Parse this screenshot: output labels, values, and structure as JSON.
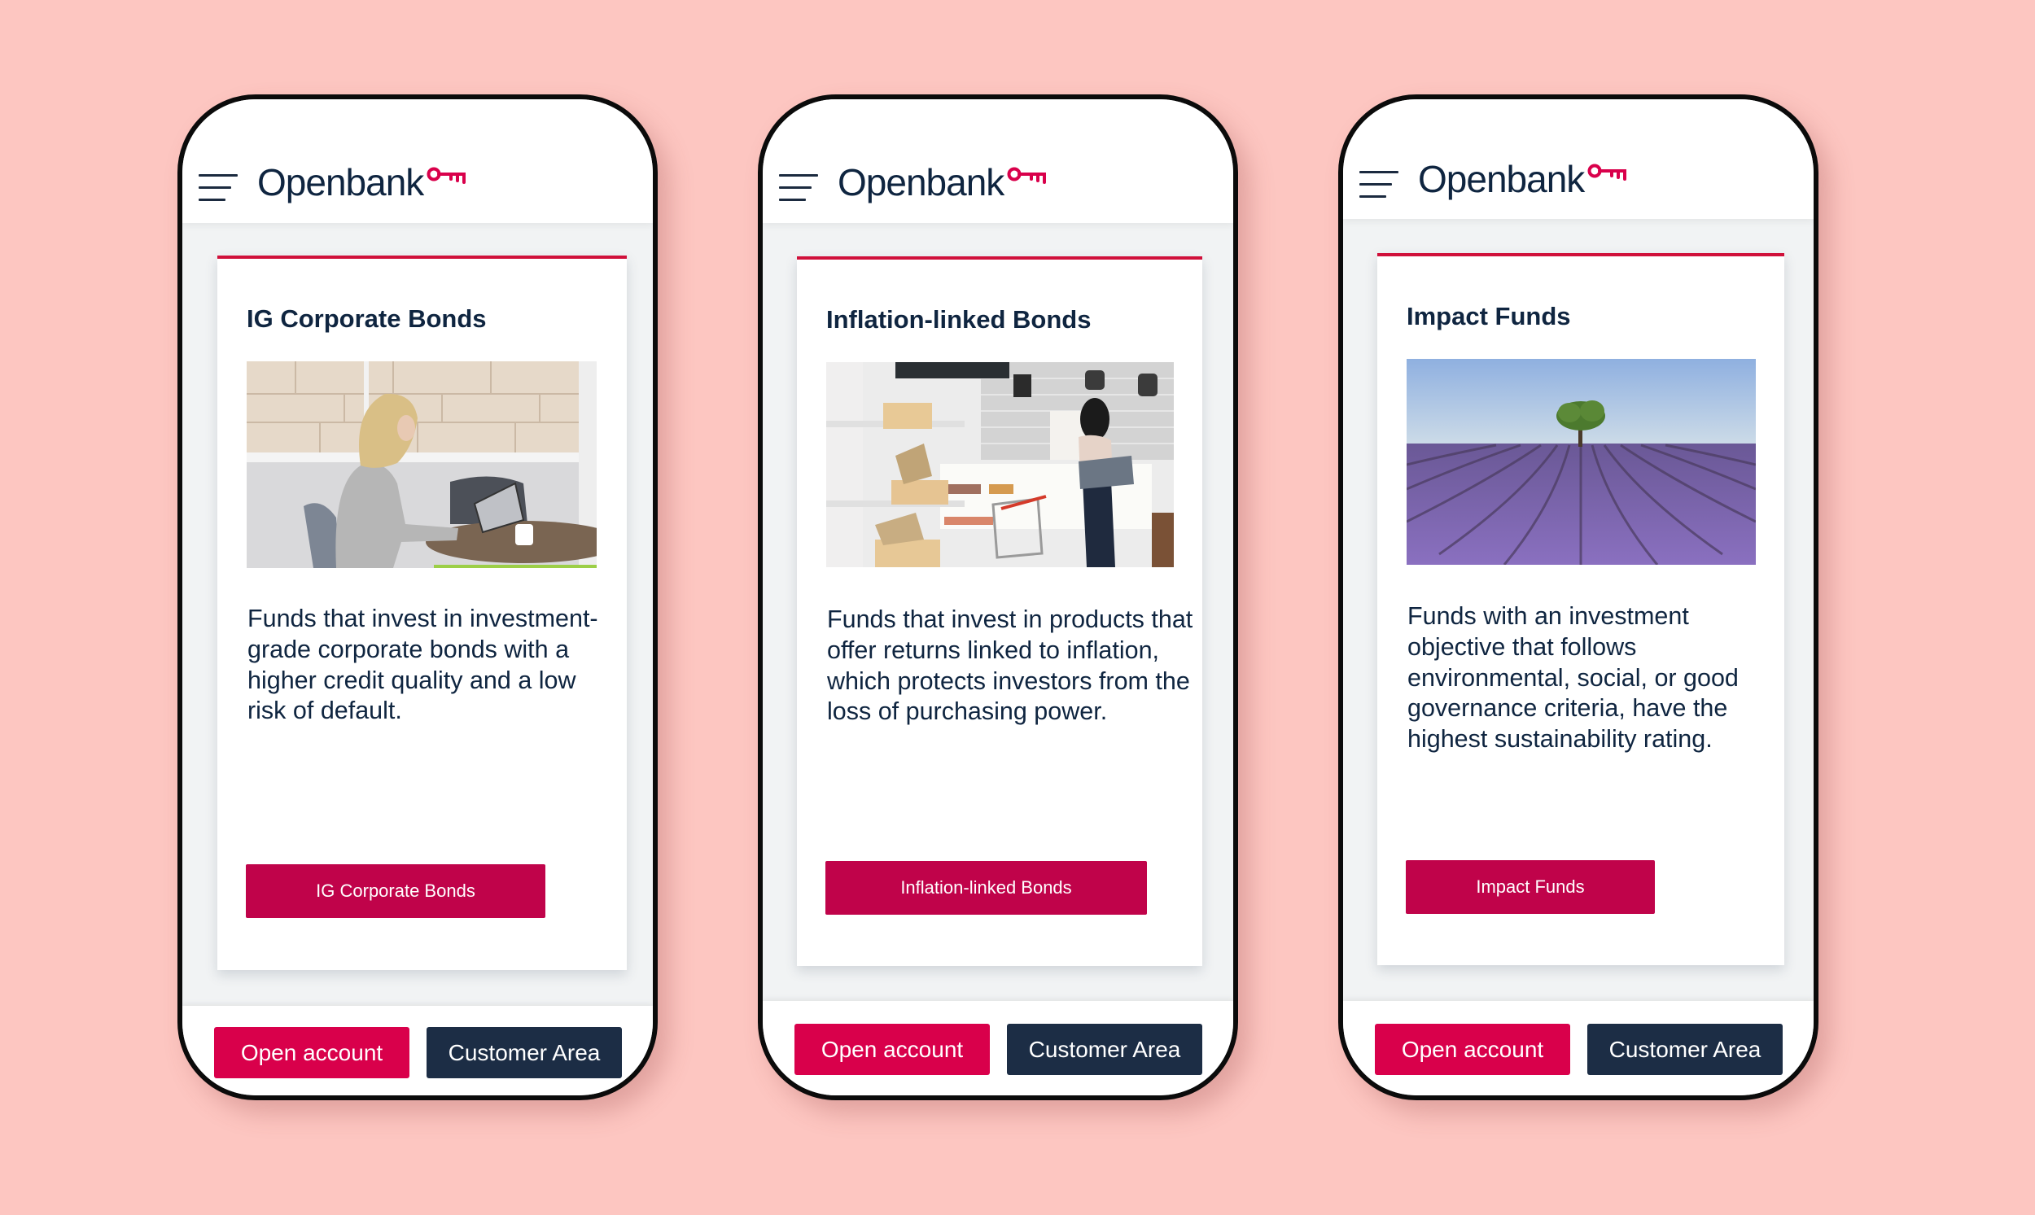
{
  "brand": {
    "name": "Openbank",
    "colors": {
      "background": "#fdc6c1",
      "primary_red": "#d9004b",
      "cta_red": "#c0034a",
      "navy": "#1c2d45",
      "text": "#0f2540",
      "accent_line": "#d0103a"
    }
  },
  "icons": {
    "menu": "hamburger-menu-icon",
    "logo_key": "key-icon"
  },
  "phones": [
    {
      "header": {
        "logo_text": "Openbank"
      },
      "card": {
        "title": "IG Corporate Bonds",
        "image_alt": "Woman working on a laptop at an office desk",
        "description": "Funds that invest in investment-grade corporate bonds with a higher credit quality and a low risk of default.",
        "cta_label": "IG Corporate Bonds"
      },
      "footer": {
        "open_account_label": "Open account",
        "customer_area_label": "Customer Area"
      }
    },
    {
      "header": {
        "logo_text": "Openbank"
      },
      "card": {
        "title": "Inflation-linked Bonds",
        "image_alt": "Woman with shopping cart in a grocery store",
        "description": "Funds that invest in products that offer returns linked to inflation, which protects investors from the loss of purchasing power.",
        "cta_label": "Inflation-linked Bonds"
      },
      "footer": {
        "open_account_label": "Open account",
        "customer_area_label": "Customer Area"
      }
    },
    {
      "header": {
        "logo_text": "Openbank"
      },
      "card": {
        "title": "Impact Funds",
        "image_alt": "Lavender field with a single tree on the horizon",
        "description": "Funds with an investment objective that follows environmental, social, or good governance criteria, have the highest sustainability rating.",
        "cta_label": "Impact Funds"
      },
      "footer": {
        "open_account_label": "Open account",
        "customer_area_label": "Customer Area"
      }
    }
  ]
}
